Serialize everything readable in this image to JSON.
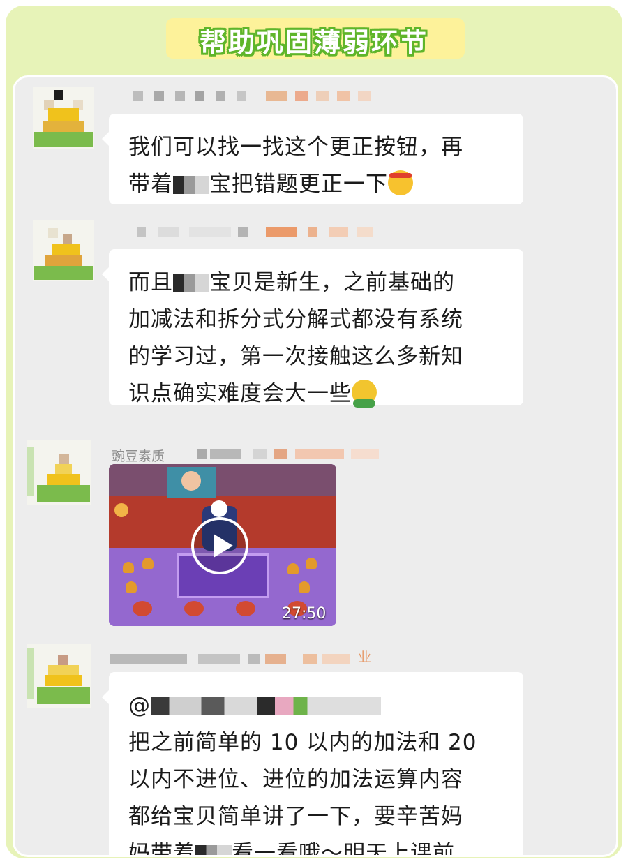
{
  "header": {
    "title": "帮助巩固薄弱环节"
  },
  "messages": [
    {
      "type": "text",
      "line1": "我们可以找一找这个更正按钮，再",
      "line2_a": "带着",
      "line2_b": "宝把错题更正一下",
      "emoji": "headband-emoji"
    },
    {
      "type": "text",
      "line1_a": "而且",
      "line1_b": "宝贝是新生，之前基础的",
      "line2": "加减法和拆分式分解式都没有系统",
      "line3": "的学习过，第一次接触这么多新知",
      "line4": "识点确实难度会大一些",
      "emoji": "shrug-emoji"
    },
    {
      "type": "video",
      "sender_prefix": "豌豆素质",
      "duration": "27:50"
    },
    {
      "type": "text",
      "sender_suffix": "业",
      "mention": "@",
      "line1": "把之前简单的 10 以内的加法和 20",
      "line2": "以内不进位、进位的加法运算内容",
      "line3": "都给宝贝简单讲了一下，要辛苦妈",
      "line4_a": "妈带着",
      "line4_b": "看一看哦～明天上课前"
    }
  ],
  "colors": {
    "frame": "#e7f3b8",
    "title_outline": "#5fb52a",
    "title_band": "#fdf29a",
    "chat_bg": "#ededed"
  }
}
